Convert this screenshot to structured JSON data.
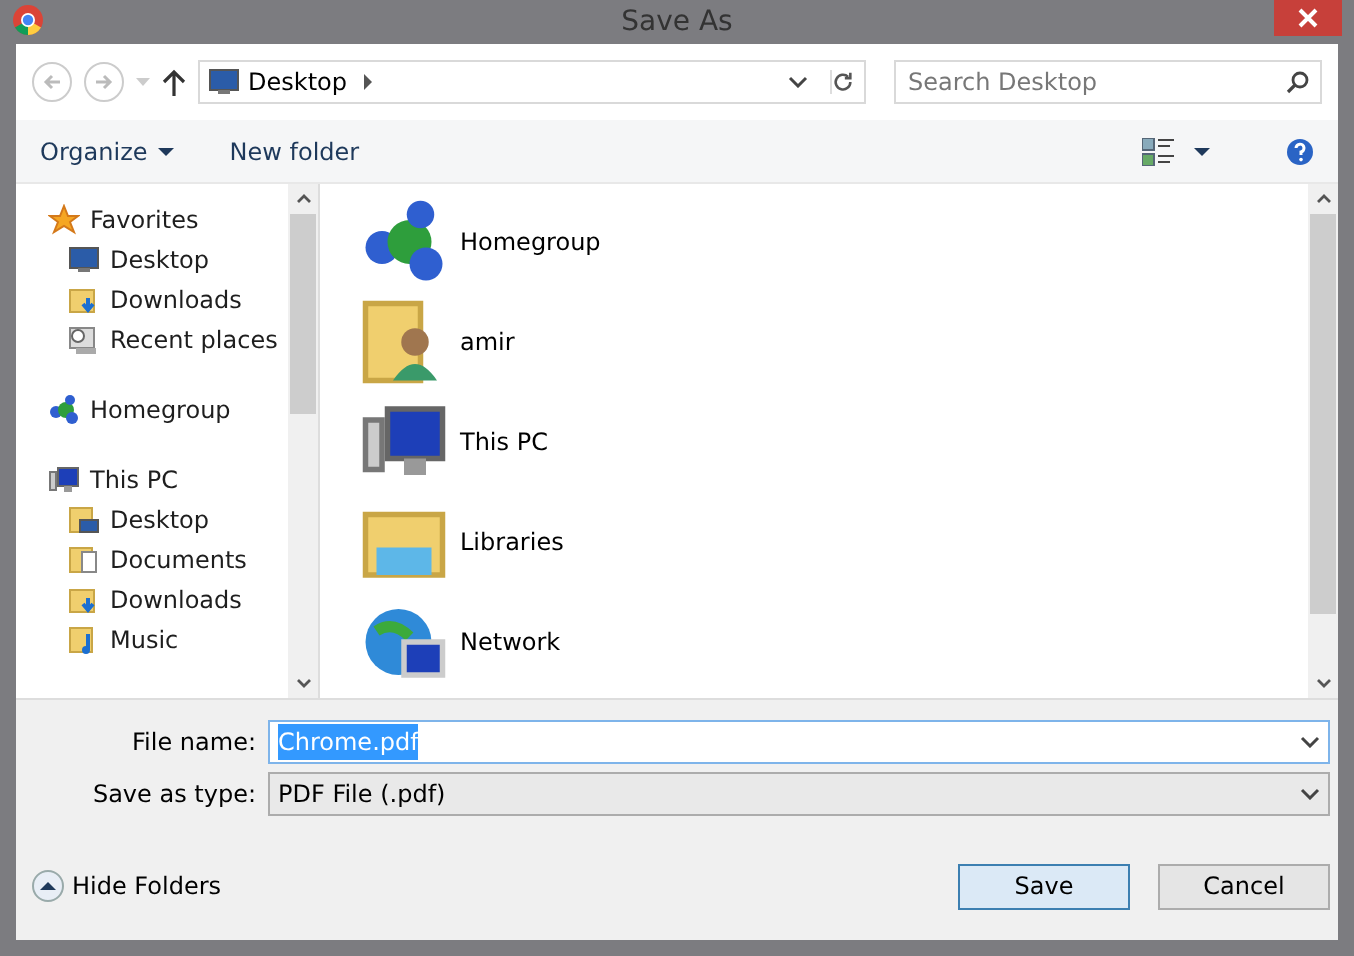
{
  "window": {
    "title": "Save As"
  },
  "address": {
    "path": "Desktop"
  },
  "search": {
    "placeholder": "Search Desktop"
  },
  "toolbar": {
    "buttons": [
      {
        "label": "Organize",
        "dropdown": true
      },
      {
        "label": "New folder",
        "dropdown": false
      }
    ]
  },
  "sidebar": {
    "groups": [
      {
        "label": "Favorites",
        "kind": "star",
        "children": [
          {
            "label": "Desktop",
            "kind": "desktop"
          },
          {
            "label": "Downloads",
            "kind": "downloads"
          },
          {
            "label": "Recent places",
            "kind": "recent"
          }
        ]
      },
      {
        "label": "Homegroup",
        "kind": "homegroup"
      },
      {
        "label": "This PC",
        "kind": "pc",
        "children": [
          {
            "label": "Desktop",
            "kind": "desktop-folder"
          },
          {
            "label": "Documents",
            "kind": "documents"
          },
          {
            "label": "Downloads",
            "kind": "downloads"
          },
          {
            "label": "Music",
            "kind": "music"
          }
        ]
      }
    ]
  },
  "items": [
    {
      "label": "Homegroup",
      "kind": "homegroup"
    },
    {
      "label": "amir",
      "kind": "user"
    },
    {
      "label": "This PC",
      "kind": "pc"
    },
    {
      "label": "Libraries",
      "kind": "libraries"
    },
    {
      "label": "Network",
      "kind": "network"
    }
  ],
  "file_name": {
    "label": "File name:",
    "value": "Chrome.pdf",
    "text_selected": true
  },
  "save_type": {
    "label": "Save as type:",
    "value": "PDF File (.pdf)"
  },
  "hide_folders": {
    "label": "Hide Folders"
  },
  "buttons": [
    {
      "label": "Save",
      "default": true
    },
    {
      "label": "Cancel",
      "default": false
    }
  ]
}
